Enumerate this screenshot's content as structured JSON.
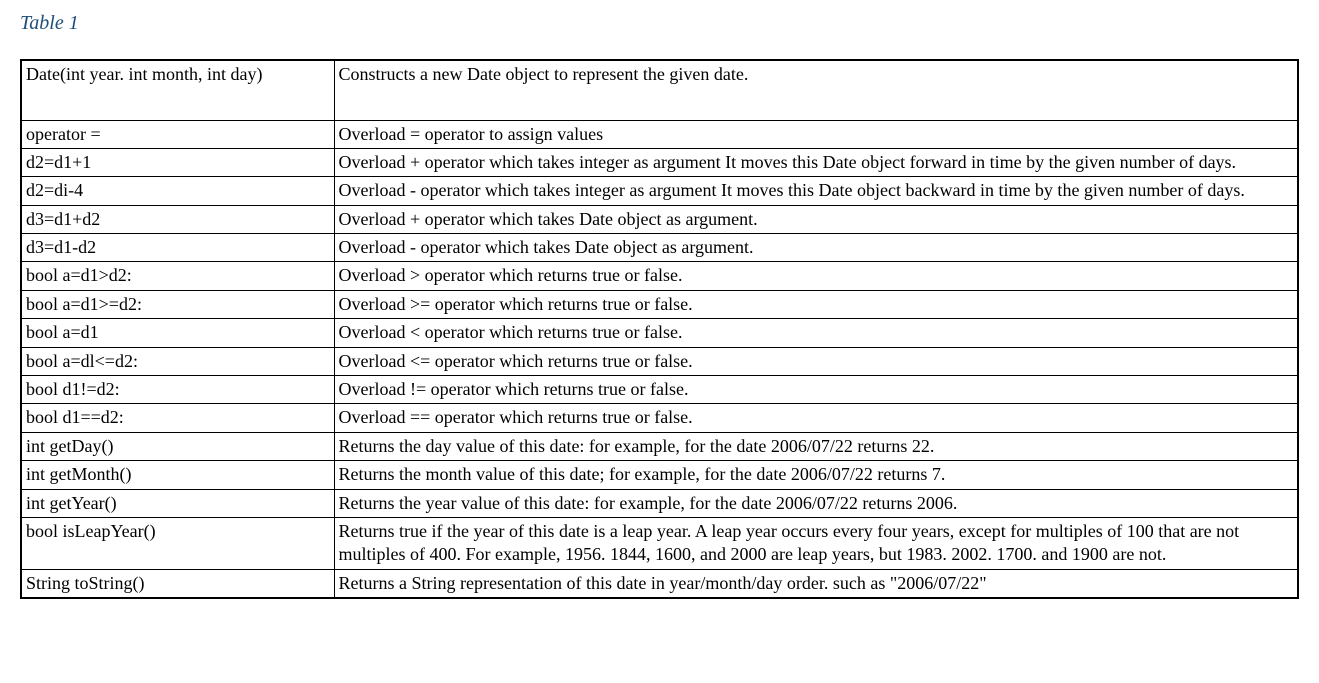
{
  "title": "Table 1",
  "rows": [
    {
      "c1": "Date(int year. int month, int day)",
      "c2": "Constructs a new Date object to represent the given date."
    },
    {
      "c1": "operator =",
      "c2": "Overload = operator to assign values"
    },
    {
      "c1": "d2=d1+1",
      "c2": "Overload + operator which takes integer as argument It moves this Date object forward in time by the given number of days."
    },
    {
      "c1": "d2=di-4",
      "c2": "Overload - operator which takes integer as argument It moves this Date object backward in time by the given number of days."
    },
    {
      "c1": "d3=d1+d2",
      "c2": "Overload + operator which takes Date object as argument."
    },
    {
      "c1": "d3=d1-d2",
      "c2": "Overload - operator which takes Date object as argument."
    },
    {
      "c1": "bool a=d1>d2:",
      "c2": "Overload > operator which returns true or false."
    },
    {
      "c1": "bool a=d1>=d2:",
      "c2": "Overload >= operator which returns true or false."
    },
    {
      "c1": "bool a=d1",
      "c2": "Overload < operator which returns true or false."
    },
    {
      "c1": "bool a=dl<=d2:",
      "c2": "Overload <= operator which returns true or false."
    },
    {
      "c1": "bool d1!=d2:",
      "c2": "Overload != operator which returns true or false."
    },
    {
      "c1": "bool d1==d2:",
      "c2": "Overload == operator which returns true or false."
    },
    {
      "c1": "int getDay()",
      "c2": "Returns the day value of this date: for example, for the date 2006/07/22 returns 22."
    },
    {
      "c1": "int getMonth()",
      "c2": "Returns the month value of this date; for example, for the date 2006/07/22 returns 7."
    },
    {
      "c1": "int getYear()",
      "c2": "Returns the year value of this date: for example, for the date 2006/07/22 returns 2006."
    },
    {
      "c1": "bool isLeapYear()",
      "c2": "Returns true if the year of this date is a leap year. A leap year occurs every four years, except for multiples of 100 that are not multiples of 400. For example, 1956. 1844, 1600, and 2000 are leap years, but 1983. 2002. 1700. and 1900 are not."
    },
    {
      "c1": "String toString()",
      "c2": "Returns a String representation of this date in year/month/day order. such as \"2006/07/22\""
    }
  ]
}
